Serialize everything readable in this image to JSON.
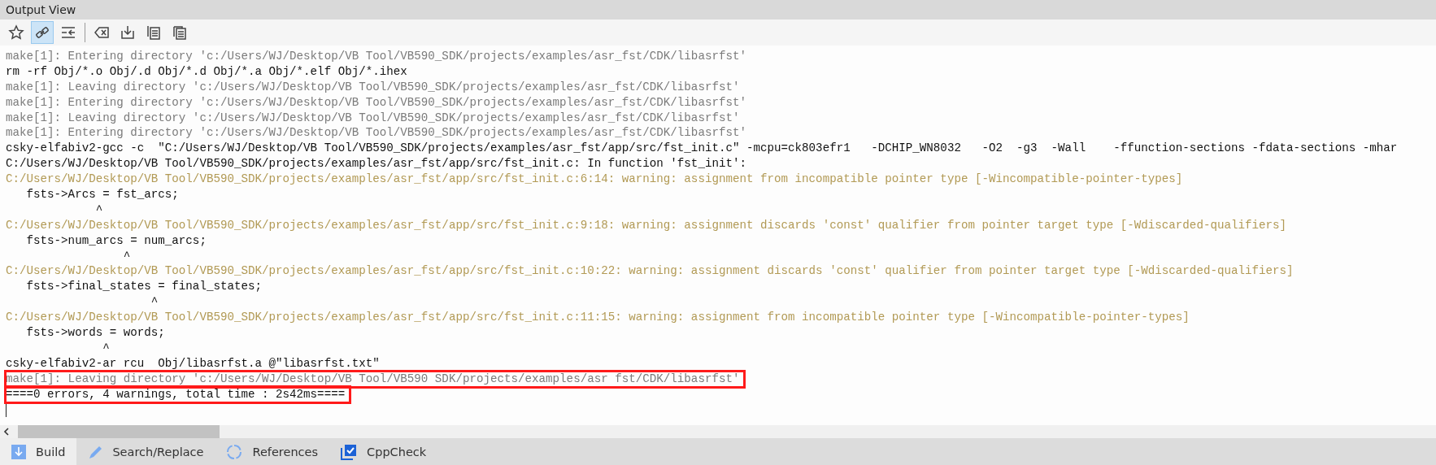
{
  "panel": {
    "title": "Output View"
  },
  "toolbar_groups": [
    [
      {
        "kind": "star"
      },
      {
        "kind": "link",
        "on": true
      },
      {
        "kind": "indent"
      }
    ],
    [
      {
        "kind": "clear"
      },
      {
        "kind": "save"
      },
      {
        "kind": "copy"
      },
      {
        "kind": "paste"
      }
    ]
  ],
  "log_lines": [
    {
      "kind": "info",
      "text": "make[1]: Entering directory 'c:/Users/WJ/Desktop/VB Tool/VB590_SDK/projects/examples/asr_fst/CDK/libasrfst'",
      "highlighted": false
    },
    {
      "kind": "command",
      "text": "rm -rf Obj/*.o Obj/.d Obj/*.d Obj/*.a Obj/*.elf Obj/*.ihex",
      "highlighted": false
    },
    {
      "kind": "info",
      "text": "make[1]: Leaving directory 'c:/Users/WJ/Desktop/VB Tool/VB590_SDK/projects/examples/asr_fst/CDK/libasrfst'",
      "highlighted": false
    },
    {
      "kind": "info",
      "text": "make[1]: Entering directory 'c:/Users/WJ/Desktop/VB Tool/VB590_SDK/projects/examples/asr_fst/CDK/libasrfst'",
      "highlighted": false
    },
    {
      "kind": "info",
      "text": "make[1]: Leaving directory 'c:/Users/WJ/Desktop/VB Tool/VB590_SDK/projects/examples/asr_fst/CDK/libasrfst'",
      "highlighted": false
    },
    {
      "kind": "info",
      "text": "make[1]: Entering directory 'c:/Users/WJ/Desktop/VB Tool/VB590_SDK/projects/examples/asr_fst/CDK/libasrfst'",
      "highlighted": false
    },
    {
      "kind": "command",
      "text": "csky-elfabiv2-gcc -c  \"C:/Users/WJ/Desktop/VB Tool/VB590_SDK/projects/examples/asr_fst/app/src/fst_init.c\" -mcpu=ck803efr1   -DCHIP_WN8032   -O2  -g3  -Wall    -ffunction-sections -fdata-sections -mhar",
      "highlighted": false
    },
    {
      "kind": "command",
      "text": "C:/Users/WJ/Desktop/VB Tool/VB590_SDK/projects/examples/asr_fst/app/src/fst_init.c: In function 'fst_init':",
      "highlighted": false
    },
    {
      "kind": "warning",
      "text": "C:/Users/WJ/Desktop/VB Tool/VB590_SDK/projects/examples/asr_fst/app/src/fst_init.c:6:14: warning: assignment from incompatible pointer type [-Wincompatible-pointer-types]",
      "highlighted": false
    },
    {
      "kind": "command",
      "text": "   fsts->Arcs = fst_arcs;",
      "highlighted": false
    },
    {
      "kind": "command",
      "text": "             ^",
      "highlighted": false
    },
    {
      "kind": "warning",
      "text": "C:/Users/WJ/Desktop/VB Tool/VB590_SDK/projects/examples/asr_fst/app/src/fst_init.c:9:18: warning: assignment discards 'const' qualifier from pointer target type [-Wdiscarded-qualifiers]",
      "highlighted": false
    },
    {
      "kind": "command",
      "text": "   fsts->num_arcs = num_arcs;",
      "highlighted": false
    },
    {
      "kind": "command",
      "text": "                 ^",
      "highlighted": false
    },
    {
      "kind": "warning",
      "text": "C:/Users/WJ/Desktop/VB Tool/VB590_SDK/projects/examples/asr_fst/app/src/fst_init.c:10:22: warning: assignment discards 'const' qualifier from pointer target type [-Wdiscarded-qualifiers]",
      "highlighted": false
    },
    {
      "kind": "command",
      "text": "   fsts->final_states = final_states;",
      "highlighted": false
    },
    {
      "kind": "command",
      "text": "                     ^",
      "highlighted": false
    },
    {
      "kind": "warning",
      "text": "C:/Users/WJ/Desktop/VB Tool/VB590_SDK/projects/examples/asr_fst/app/src/fst_init.c:11:15: warning: assignment from incompatible pointer type [-Wincompatible-pointer-types]",
      "highlighted": false
    },
    {
      "kind": "command",
      "text": "   fsts->words = words;",
      "highlighted": false
    },
    {
      "kind": "command",
      "text": "              ^",
      "highlighted": false
    },
    {
      "kind": "command",
      "text": "csky-elfabiv2-ar rcu  Obj/libasrfst.a @\"libasrfst.txt\"",
      "highlighted": false
    },
    {
      "kind": "info",
      "text": "make[1]: Leaving directory 'c:/Users/WJ/Desktop/VB Tool/VB590 SDK/projects/examples/asr fst/CDK/libasrfst'",
      "highlighted": true
    },
    {
      "kind": "command",
      "text": "====0 errors, 4 warnings, total time : 2s42ms====",
      "highlighted": true
    }
  ],
  "tabs": [
    {
      "kind": "build",
      "label": "Build",
      "selected": true
    },
    {
      "kind": "search",
      "label": "Search/Replace",
      "selected": false
    },
    {
      "kind": "references",
      "label": "References",
      "selected": false
    },
    {
      "kind": "check",
      "label": "CppCheck",
      "selected": false
    }
  ]
}
